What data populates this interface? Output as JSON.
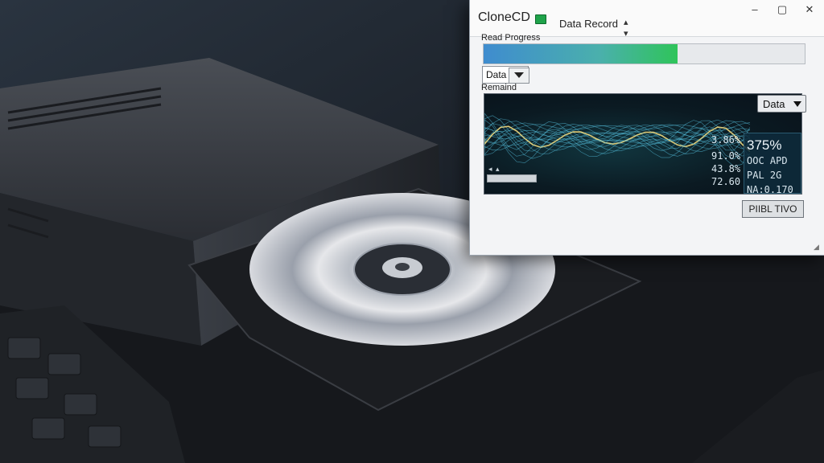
{
  "window": {
    "title": "CloneCD",
    "mode_label": "Data Record",
    "mode_sort_icon": "sort-arrows-icon",
    "disc_status_icon": "disc-status-icon",
    "controls": {
      "minimize": "–",
      "maximize": "▢",
      "close": "✕"
    }
  },
  "progress": {
    "label": "Read Progress",
    "fraction": 0.605
  },
  "source": {
    "value": "Data",
    "dropdown_icon": "chevron-down-icon"
  },
  "remaining": {
    "label": "Remaind"
  },
  "view_dropdown": {
    "label": "Data"
  },
  "readouts": {
    "col1": [
      "3.86%",
      "91.0%",
      "43.8%",
      "72.60"
    ],
    "highlight": "375%",
    "col2": [
      "OOC APD",
      "PAL 2G",
      "NA:0.170"
    ]
  },
  "panel": {
    "scroll_left": "◂",
    "scroll_marker": "▴"
  },
  "action_button": {
    "label": "PIIBL TIVO"
  },
  "colors": {
    "progress_start": "#3f8ccf",
    "progress_end": "#2fc45a",
    "panel_bg": "#0b1a22",
    "wave": "#5ac8e8",
    "wave_accent": "#e7d27a"
  }
}
